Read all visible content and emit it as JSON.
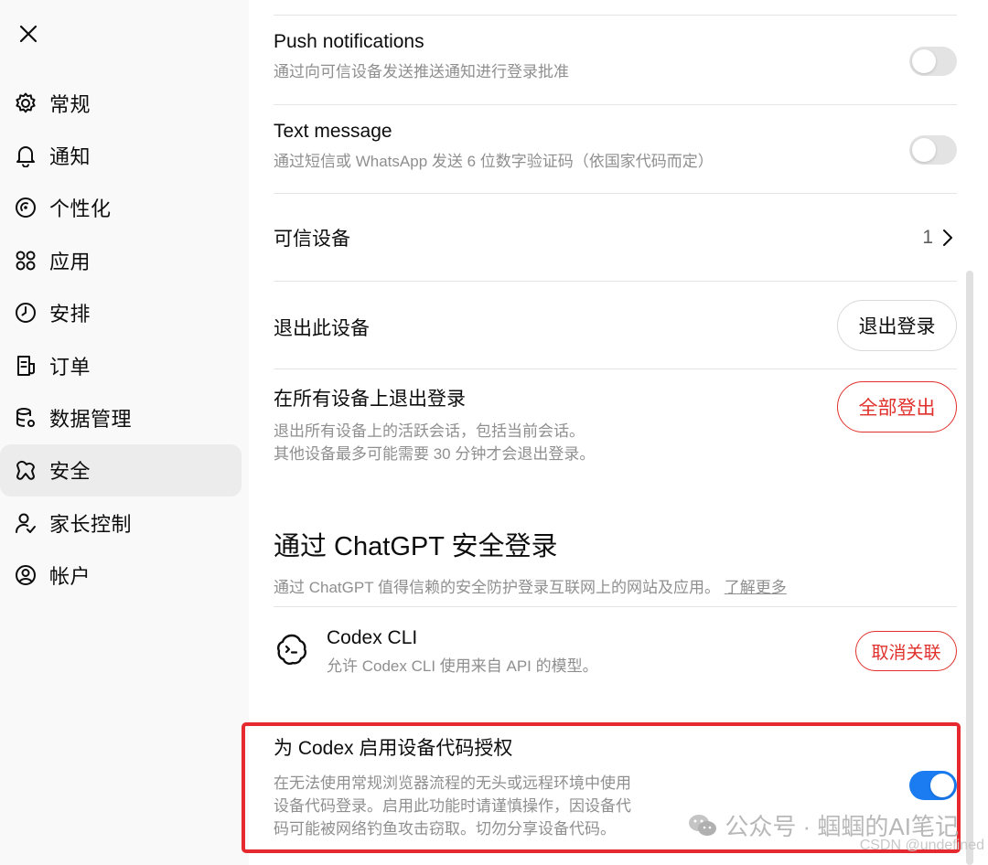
{
  "sidebar": {
    "items": [
      {
        "label": "常规",
        "icon": "gear-icon"
      },
      {
        "label": "通知",
        "icon": "bell-icon"
      },
      {
        "label": "个性化",
        "icon": "personalization-icon"
      },
      {
        "label": "应用",
        "icon": "apps-grid-icon"
      },
      {
        "label": "安排",
        "icon": "clock-icon"
      },
      {
        "label": "订单",
        "icon": "receipt-icon"
      },
      {
        "label": "数据管理",
        "icon": "database-gear-icon"
      },
      {
        "label": "安全",
        "icon": "security-icon"
      },
      {
        "label": "家长控制",
        "icon": "parent-user-icon"
      },
      {
        "label": "帐户",
        "icon": "account-icon"
      }
    ],
    "active_index": 7
  },
  "security": {
    "push": {
      "title": "Push notifications",
      "desc": "通过向可信设备发送推送通知进行登录批准",
      "enabled": false
    },
    "sms": {
      "title": "Text message",
      "desc": "通过短信或 WhatsApp 发送 6 位数字验证码（依国家代码而定）",
      "enabled": false
    },
    "trusted": {
      "title": "可信设备",
      "count": "1"
    },
    "logout_device": {
      "title": "退出此设备",
      "button": "退出登录"
    },
    "logout_all": {
      "title": "在所有设备上退出登录",
      "desc_line1": "退出所有设备上的活跃会话，包括当前会话。",
      "desc_line2": "其他设备最多可能需要 30 分钟才会退出登录。",
      "button": "全部登出"
    },
    "chatgpt_login": {
      "heading": "通过 ChatGPT 安全登录",
      "desc": "通过 ChatGPT 值得信赖的安全防护登录互联网上的网站及应用。",
      "link": "了解更多"
    },
    "codex_cli": {
      "title": "Codex CLI",
      "desc": "允许 Codex CLI 使用来自 API 的模型。",
      "button": "取消关联"
    },
    "codex_device_code": {
      "title": "为 Codex 启用设备代码授权",
      "desc_line1": "在无法使用常规浏览器流程的无头或远程环境中使用",
      "desc_line2": "设备代码登录。启用此功能时请谨慎操作，因设备代",
      "desc_line3": "码可能被网络钓鱼攻击窃取。切勿分享设备代码。",
      "enabled": true
    }
  },
  "watermark": {
    "text": "公众号 · 蝈蝈的AI笔记",
    "sub": "CSDN @undefined"
  },
  "colors": {
    "accent": "#1b7cf2",
    "danger": "#e0302b",
    "highlight_box": "#e5292e"
  }
}
